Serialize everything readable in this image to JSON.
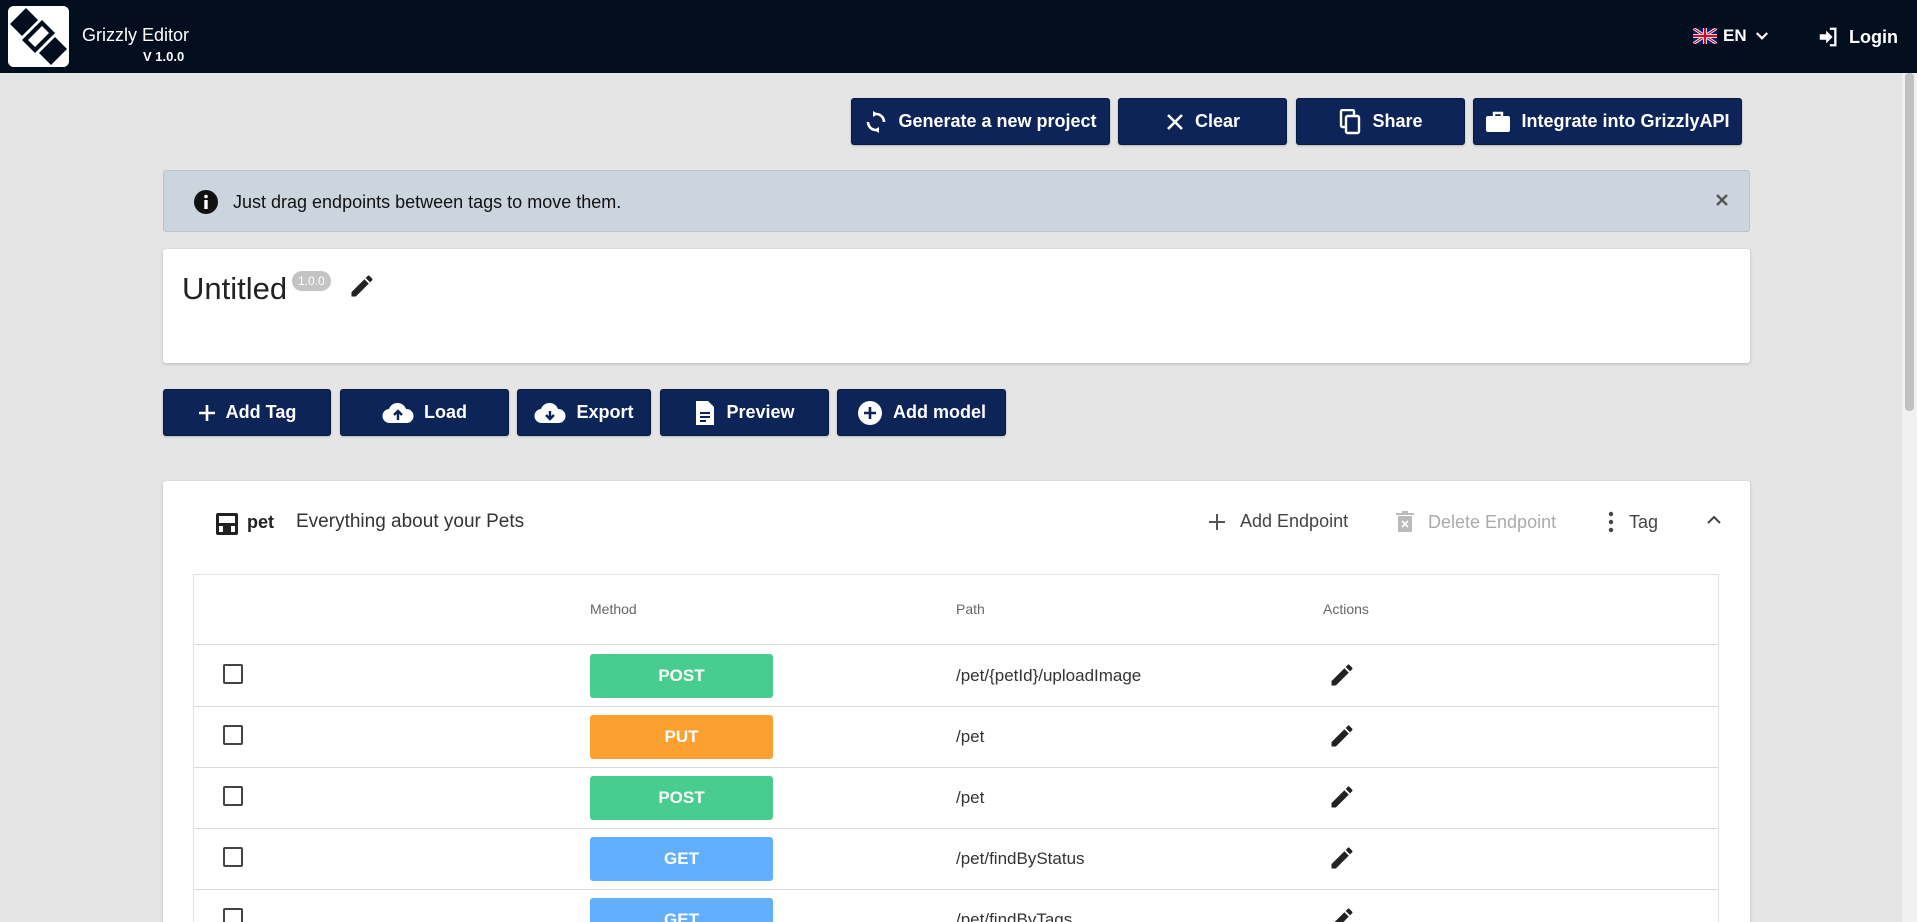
{
  "header": {
    "app_name": "Grizzly Editor",
    "version": "V 1.0.0",
    "language": "EN",
    "login_label": "Login"
  },
  "toolbar": {
    "generate_label": "Generate a new project",
    "clear_label": "Clear",
    "share_label": "Share",
    "integrate_label": "Integrate into GrizzlyAPI"
  },
  "alert": {
    "text": "Just drag endpoints between tags to move them."
  },
  "project": {
    "title": "Untitled",
    "version": "1.0.0"
  },
  "actions": {
    "add_tag": "Add Tag",
    "load": "Load",
    "export": "Export",
    "preview": "Preview",
    "add_model": "Add model"
  },
  "tag": {
    "name": "pet",
    "description": "Everything about your Pets",
    "add_endpoint": "Add Endpoint",
    "delete_endpoint": "Delete Endpoint",
    "tag_menu": "Tag"
  },
  "table": {
    "headers": {
      "method": "Method",
      "path": "Path",
      "actions": "Actions"
    },
    "rows": [
      {
        "method": "POST",
        "path": "/pet/{petId}/uploadImage"
      },
      {
        "method": "PUT",
        "path": "/pet"
      },
      {
        "method": "POST",
        "path": "/pet"
      },
      {
        "method": "GET",
        "path": "/pet/findByStatus"
      },
      {
        "method": "GET",
        "path": "/pet/findByTags"
      }
    ]
  },
  "colors": {
    "topbar": "#020d1d",
    "primary_button": "#0c2457",
    "post": "#49cc90",
    "put": "#fca130",
    "get": "#61affe",
    "alert_bg": "#ccd4de"
  }
}
